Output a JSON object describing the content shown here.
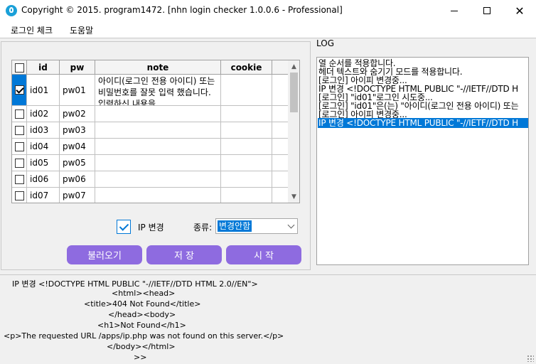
{
  "window": {
    "title": "Copyright © 2015. program1472. [nhn login checker 1.0.0.6 - Professional]",
    "icon": "app-icon",
    "minimize_icon": "minimize-icon",
    "maximize_icon": "maximize-icon",
    "close_glyph": "✕"
  },
  "menu": {
    "items": [
      "로그인 체크",
      "도움말"
    ]
  },
  "grid": {
    "columns": [
      "id",
      "pw",
      "note",
      "cookie"
    ],
    "rows": [
      {
        "checked": true,
        "id": "id01",
        "pw": "pw01",
        "note": "아이디(로그인 전용 아이디) 또는 비밀번호를 잘못 입력 했습니다. 입력하신 내용을",
        "cookie": ""
      },
      {
        "checked": false,
        "id": "id02",
        "pw": "pw02",
        "note": "",
        "cookie": ""
      },
      {
        "checked": false,
        "id": "id03",
        "pw": "pw03",
        "note": "",
        "cookie": ""
      },
      {
        "checked": false,
        "id": "id04",
        "pw": "pw04",
        "note": "",
        "cookie": ""
      },
      {
        "checked": false,
        "id": "id05",
        "pw": "pw05",
        "note": "",
        "cookie": ""
      },
      {
        "checked": false,
        "id": "id06",
        "pw": "pw06",
        "note": "",
        "cookie": ""
      },
      {
        "checked": false,
        "id": "id07",
        "pw": "pw07",
        "note": "",
        "cookie": ""
      }
    ],
    "scroll_up": "▲",
    "scroll_down": "▼"
  },
  "options": {
    "ip_change_label": "IP 변경",
    "ip_change_checked": true,
    "type_label": "종류:",
    "type_value": "변경안함"
  },
  "buttons": {
    "load": "불러오기",
    "save": "저 장",
    "start": "시 작"
  },
  "log": {
    "label": "LOG",
    "lines": [
      "열 순서를 적용합니다.",
      "헤더 텍스트와 숨기기 모드를 적용합니다.",
      "[로그인] 아이피 변경중...",
      "IP 변경 <!DOCTYPE HTML PUBLIC \"-//IETF//DTD H",
      "[로그인] \"id01\"로그인 시도중...",
      "[로그인] \"id01\"은(는) \"아이디(로그인 전용 아이디) 또는",
      "[로그인] 아이피 변경중...",
      "IP 변경 <!DOCTYPE HTML PUBLIC \"-//IETF//DTD H"
    ],
    "selected_index": 7
  },
  "bottom": {
    "lines": [
      "IP 변경 <!DOCTYPE HTML PUBLIC \"-//IETF//DTD HTML 2.0//EN\">",
      "<html><head>",
      "<title>404 Not Found</title>",
      "</head><body>",
      "<h1>Not Found</h1>",
      "<p>The requested URL /apps/ip.php was not found on this server.</p>",
      "</body></html>",
      ">>"
    ]
  },
  "colors": {
    "button": "#8e6be0",
    "selection": "#0078d7"
  }
}
